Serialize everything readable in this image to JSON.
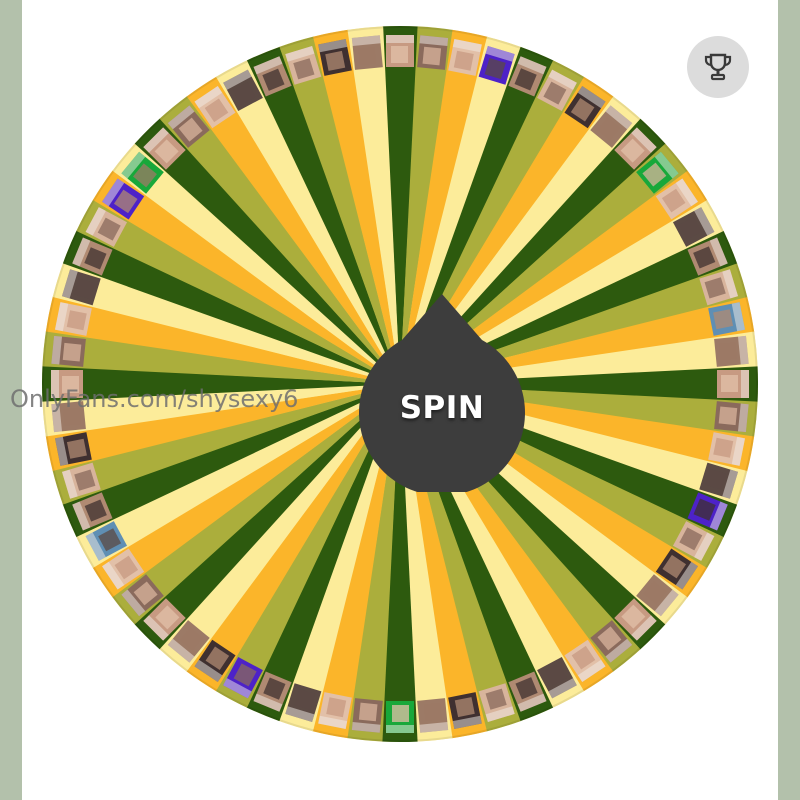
{
  "spin_button": {
    "label": "SPIN"
  },
  "leaderboard": {
    "icon": "trophy-icon"
  },
  "watermark": {
    "text": "OnlyFans.com/shysexy6"
  },
  "wheel": {
    "segment_count": 64,
    "colors": [
      "#2d5a0e",
      "#abae3c",
      "#fbb52a",
      "#fcec9a"
    ],
    "thumbnail_tones": [
      "#c79a82",
      "#8a6a5c",
      "#e2c0a8",
      "#5b4a44",
      "#b08a72",
      "#d8b49c",
      "#3f3030",
      "#9c7a66"
    ],
    "thumbnail_accents": [
      "#4d22c8",
      "#18a83a",
      "#5f8fb4"
    ]
  },
  "colors": {
    "page_background": "#b3c1ab",
    "panel_background": "#ffffff",
    "spin_button": "#3d3d3d",
    "spin_text": "#ffffff",
    "trophy_button": "#dcdcdc",
    "trophy_icon": "#3a3a3a"
  }
}
